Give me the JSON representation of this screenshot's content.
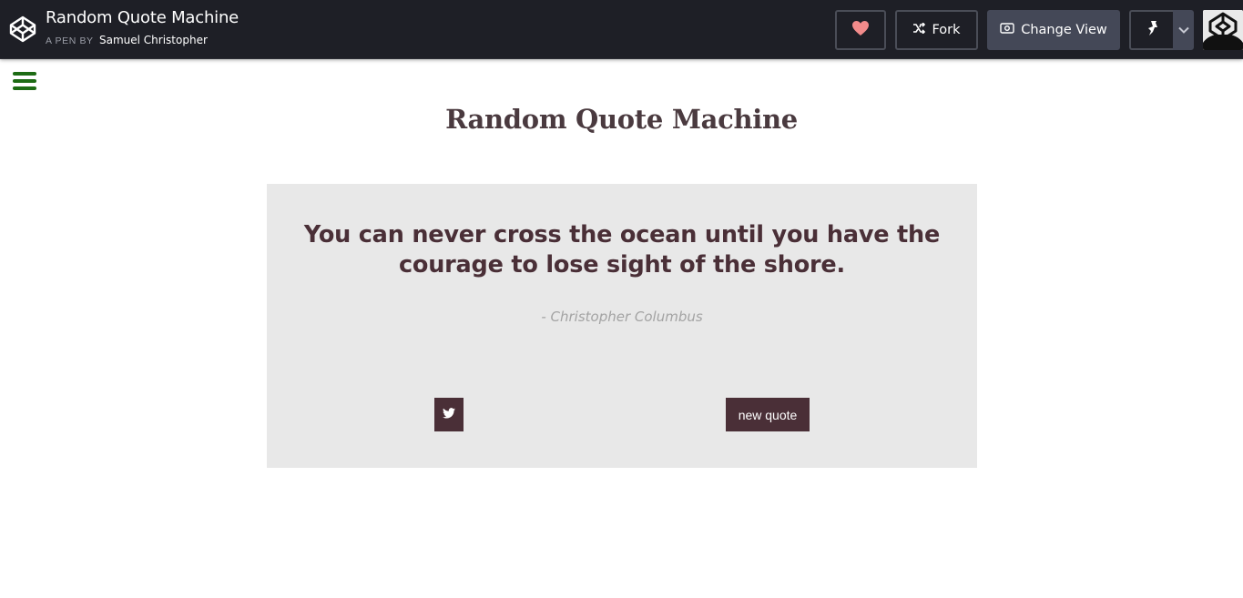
{
  "header": {
    "pen_title": "Random Quote Machine",
    "a_pen_by": "A PEN BY",
    "author": "Samuel Christopher",
    "fork_label": "Fork",
    "change_view_label": "Change View",
    "icons": [
      "codepen-logo-icon",
      "heart-icon",
      "fork-icon",
      "eye-icon",
      "pin-icon",
      "chevron-down-icon"
    ],
    "heart_color": "#f28b8b"
  },
  "app": {
    "heading": "Random Quote Machine",
    "menu_icon": "hamburger-menu-icon",
    "menu_color": "#1d6b14"
  },
  "quote": {
    "text": "You can never cross the ocean until you have the courage to lose sight of the shore.",
    "author": "- Christopher Columbus",
    "new_quote_label": "new quote",
    "tweet_icon": "twitter-icon",
    "accent_color": "#4a2f37",
    "box_color": "#e8e8e8"
  }
}
